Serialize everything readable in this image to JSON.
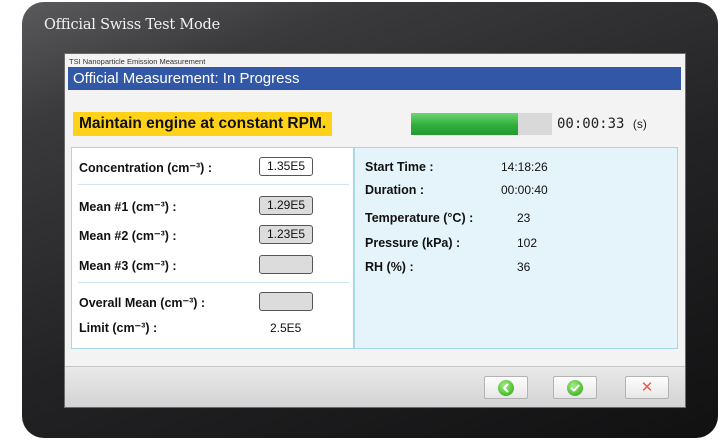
{
  "device": {
    "title": "Official Swiss Test Mode"
  },
  "window": {
    "app_title": "TSI Nanoparticle Emission Measurement"
  },
  "header": {
    "title": "Official Measurement: In Progress"
  },
  "status": {
    "instruction": "Maintain engine at constant RPM.",
    "progress_percent": 76,
    "timer": "00:00:33",
    "timer_unit": "(s)"
  },
  "measurements": {
    "concentration_label": "Concentration (cm⁻³) :",
    "concentration_value": "1.35E5",
    "mean1_label": "Mean #1 (cm⁻³) :",
    "mean1_value": "1.29E5",
    "mean2_label": "Mean #2 (cm⁻³) :",
    "mean2_value": "1.23E5",
    "mean3_label": "Mean #3 (cm⁻³) :",
    "mean3_value": "",
    "overall_label": "Overall Mean (cm⁻³) :",
    "overall_value": "",
    "limit_label": "Limit (cm⁻³) :",
    "limit_value": "2.5E5"
  },
  "info": {
    "start_time_label": "Start Time :",
    "start_time_value": "14:18:26",
    "duration_label": "Duration :",
    "duration_value": "00:00:40",
    "temperature_label": "Temperature (°C) :",
    "temperature_value": "23",
    "pressure_label": "Pressure (kPa) :",
    "pressure_value": "102",
    "rh_label": "RH (%) :",
    "rh_value": "36"
  },
  "footer": {
    "buttons": [
      {
        "icon": "back-arrow-icon",
        "enabled": true
      },
      {
        "icon": "checkmark-icon",
        "enabled": true
      },
      {
        "icon": "close-icon",
        "enabled": true
      }
    ]
  },
  "colors": {
    "header": "#3157a6",
    "highlight": "#ffd21a",
    "progress": "#2fae3c",
    "info_panel": "#e5f4fb"
  }
}
